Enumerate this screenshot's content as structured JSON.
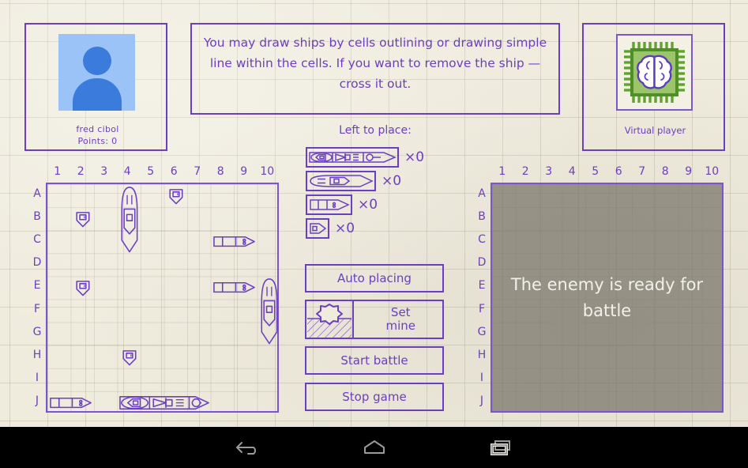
{
  "app": {
    "background_color": "#EFEBDD",
    "ink_color": "#6B3FC4",
    "grid_line_color": "#96917D"
  },
  "player_panel": {
    "name": "fred cibol",
    "points": "Points: 0",
    "avatar_icon": "person-avatar-icon",
    "avatar_bg_color": "#9CC3F7",
    "avatar_fg_color": "#3A7BDB"
  },
  "instructions": {
    "text": "You may draw ships by cells outlining or drawing simple line within the cells. If you want to remove the ship — cross it out."
  },
  "enemy_panel": {
    "name": "Virtual player",
    "avatar_icon": "ai-brain-chip-icon",
    "chip_color": "#5FA22E",
    "chip_fill": "#9CC56B",
    "brain_color": "#5B3BBF"
  },
  "left_to_place": {
    "title": "Left to place:",
    "ships": [
      {
        "name": "battleship",
        "size": 4,
        "count_label": "×0",
        "count": 0
      },
      {
        "name": "cruiser",
        "size": 3,
        "count_label": "×0",
        "count": 0
      },
      {
        "name": "destroyer",
        "size": 2,
        "count_label": "×0",
        "count": 0
      },
      {
        "name": "submarine",
        "size": 1,
        "count_label": "×0",
        "count": 0
      }
    ]
  },
  "buttons": {
    "auto_placing": "Auto placing",
    "set_mine_line1": "Set",
    "set_mine_line2": "mine",
    "start_battle": "Start battle",
    "stop_game": "Stop game"
  },
  "boards": {
    "columns": [
      "1",
      "2",
      "3",
      "4",
      "5",
      "6",
      "7",
      "8",
      "9",
      "10"
    ],
    "rows": [
      "A",
      "B",
      "C",
      "D",
      "E",
      "F",
      "G",
      "H",
      "I",
      "J"
    ],
    "player_ships": [
      {
        "size": 1,
        "col": 6,
        "row": 0,
        "orientation": "vertical"
      },
      {
        "size": 1,
        "col": 2,
        "row": 1,
        "orientation": "vertical"
      },
      {
        "size": 3,
        "col": 4,
        "row": 0,
        "orientation": "vertical"
      },
      {
        "size": 2,
        "col": 8,
        "row": 2,
        "orientation": "horizontal"
      },
      {
        "size": 1,
        "col": 2,
        "row": 4,
        "orientation": "vertical"
      },
      {
        "size": 2,
        "col": 8,
        "row": 4,
        "orientation": "horizontal"
      },
      {
        "size": 3,
        "col": 10,
        "row": 4,
        "orientation": "vertical"
      },
      {
        "size": 1,
        "col": 4,
        "row": 7,
        "orientation": "vertical"
      },
      {
        "size": 2,
        "col": 1,
        "row": 9,
        "orientation": "horizontal"
      },
      {
        "size": 4,
        "col": 4,
        "row": 9,
        "orientation": "horizontal"
      }
    ],
    "enemy_overlay_text": "The enemy is ready for battle",
    "enemy_overlay_color": "#767266"
  },
  "navbar": {
    "back_label": "back-icon",
    "home_label": "home-icon",
    "recents_label": "recents-icon"
  }
}
